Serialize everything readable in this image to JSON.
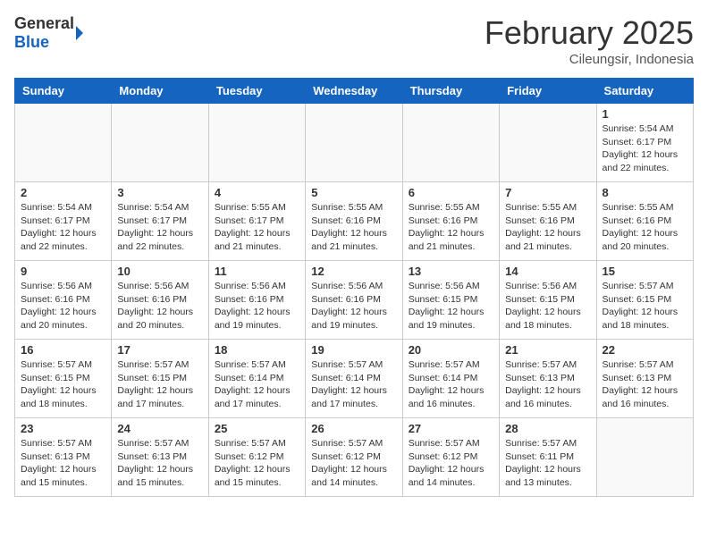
{
  "logo": {
    "general": "General",
    "blue": "Blue"
  },
  "header": {
    "title": "February 2025",
    "location": "Cileungsir, Indonesia"
  },
  "days_of_week": [
    "Sunday",
    "Monday",
    "Tuesday",
    "Wednesday",
    "Thursday",
    "Friday",
    "Saturday"
  ],
  "weeks": [
    [
      {
        "day": "",
        "info": ""
      },
      {
        "day": "",
        "info": ""
      },
      {
        "day": "",
        "info": ""
      },
      {
        "day": "",
        "info": ""
      },
      {
        "day": "",
        "info": ""
      },
      {
        "day": "",
        "info": ""
      },
      {
        "day": "1",
        "info": "Sunrise: 5:54 AM\nSunset: 6:17 PM\nDaylight: 12 hours and 22 minutes."
      }
    ],
    [
      {
        "day": "2",
        "info": "Sunrise: 5:54 AM\nSunset: 6:17 PM\nDaylight: 12 hours and 22 minutes."
      },
      {
        "day": "3",
        "info": "Sunrise: 5:54 AM\nSunset: 6:17 PM\nDaylight: 12 hours and 22 minutes."
      },
      {
        "day": "4",
        "info": "Sunrise: 5:55 AM\nSunset: 6:17 PM\nDaylight: 12 hours and 21 minutes."
      },
      {
        "day": "5",
        "info": "Sunrise: 5:55 AM\nSunset: 6:16 PM\nDaylight: 12 hours and 21 minutes."
      },
      {
        "day": "6",
        "info": "Sunrise: 5:55 AM\nSunset: 6:16 PM\nDaylight: 12 hours and 21 minutes."
      },
      {
        "day": "7",
        "info": "Sunrise: 5:55 AM\nSunset: 6:16 PM\nDaylight: 12 hours and 21 minutes."
      },
      {
        "day": "8",
        "info": "Sunrise: 5:55 AM\nSunset: 6:16 PM\nDaylight: 12 hours and 20 minutes."
      }
    ],
    [
      {
        "day": "9",
        "info": "Sunrise: 5:56 AM\nSunset: 6:16 PM\nDaylight: 12 hours and 20 minutes."
      },
      {
        "day": "10",
        "info": "Sunrise: 5:56 AM\nSunset: 6:16 PM\nDaylight: 12 hours and 20 minutes."
      },
      {
        "day": "11",
        "info": "Sunrise: 5:56 AM\nSunset: 6:16 PM\nDaylight: 12 hours and 19 minutes."
      },
      {
        "day": "12",
        "info": "Sunrise: 5:56 AM\nSunset: 6:16 PM\nDaylight: 12 hours and 19 minutes."
      },
      {
        "day": "13",
        "info": "Sunrise: 5:56 AM\nSunset: 6:15 PM\nDaylight: 12 hours and 19 minutes."
      },
      {
        "day": "14",
        "info": "Sunrise: 5:56 AM\nSunset: 6:15 PM\nDaylight: 12 hours and 18 minutes."
      },
      {
        "day": "15",
        "info": "Sunrise: 5:57 AM\nSunset: 6:15 PM\nDaylight: 12 hours and 18 minutes."
      }
    ],
    [
      {
        "day": "16",
        "info": "Sunrise: 5:57 AM\nSunset: 6:15 PM\nDaylight: 12 hours and 18 minutes."
      },
      {
        "day": "17",
        "info": "Sunrise: 5:57 AM\nSunset: 6:15 PM\nDaylight: 12 hours and 17 minutes."
      },
      {
        "day": "18",
        "info": "Sunrise: 5:57 AM\nSunset: 6:14 PM\nDaylight: 12 hours and 17 minutes."
      },
      {
        "day": "19",
        "info": "Sunrise: 5:57 AM\nSunset: 6:14 PM\nDaylight: 12 hours and 17 minutes."
      },
      {
        "day": "20",
        "info": "Sunrise: 5:57 AM\nSunset: 6:14 PM\nDaylight: 12 hours and 16 minutes."
      },
      {
        "day": "21",
        "info": "Sunrise: 5:57 AM\nSunset: 6:13 PM\nDaylight: 12 hours and 16 minutes."
      },
      {
        "day": "22",
        "info": "Sunrise: 5:57 AM\nSunset: 6:13 PM\nDaylight: 12 hours and 16 minutes."
      }
    ],
    [
      {
        "day": "23",
        "info": "Sunrise: 5:57 AM\nSunset: 6:13 PM\nDaylight: 12 hours and 15 minutes."
      },
      {
        "day": "24",
        "info": "Sunrise: 5:57 AM\nSunset: 6:13 PM\nDaylight: 12 hours and 15 minutes."
      },
      {
        "day": "25",
        "info": "Sunrise: 5:57 AM\nSunset: 6:12 PM\nDaylight: 12 hours and 15 minutes."
      },
      {
        "day": "26",
        "info": "Sunrise: 5:57 AM\nSunset: 6:12 PM\nDaylight: 12 hours and 14 minutes."
      },
      {
        "day": "27",
        "info": "Sunrise: 5:57 AM\nSunset: 6:12 PM\nDaylight: 12 hours and 14 minutes."
      },
      {
        "day": "28",
        "info": "Sunrise: 5:57 AM\nSunset: 6:11 PM\nDaylight: 12 hours and 13 minutes."
      },
      {
        "day": "",
        "info": ""
      }
    ]
  ]
}
